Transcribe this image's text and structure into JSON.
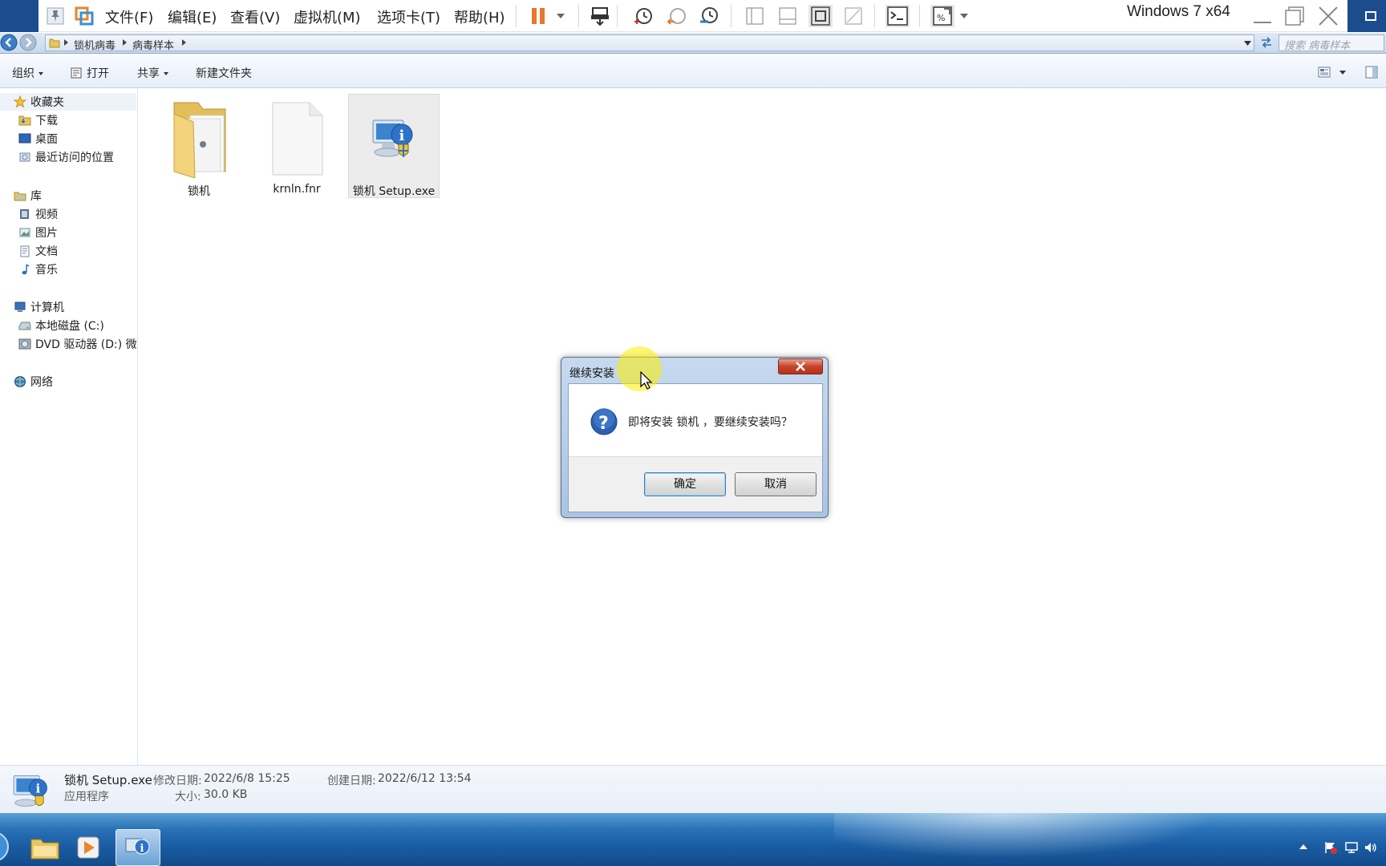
{
  "vmware": {
    "menus": [
      "文件(F)",
      "编辑(E)",
      "查看(V)",
      "虚拟机(M)",
      "选项卡(T)",
      "帮助(H)"
    ],
    "vm_name": "Windows 7 x64"
  },
  "address": {
    "breadcrumbs": [
      "锁机病毒",
      "病毒样本"
    ],
    "search_placeholder": "搜索 病毒样本"
  },
  "commands": {
    "organize": "组织",
    "open": "打开",
    "share": "共享",
    "new_folder": "新建文件夹"
  },
  "nav": {
    "favorites": "收藏夹",
    "downloads": "下载",
    "desktop": "桌面",
    "recent": "最近访问的位置",
    "libraries": "库",
    "videos": "视频",
    "pictures": "图片",
    "documents": "文档",
    "music": "音乐",
    "computer": "计算机",
    "local_disk": "本地磁盘 (C:)",
    "dvd": "DVD 驱动器 (D:) 微P",
    "network": "网络"
  },
  "files": [
    {
      "name": "锁机",
      "type": "folder"
    },
    {
      "name": "krnln.fnr",
      "type": "file"
    },
    {
      "name": "锁机 Setup.exe",
      "type": "installer",
      "selected": true
    }
  ],
  "details": {
    "name": "锁机 Setup.exe",
    "type": "应用程序",
    "modified_label": "修改日期:",
    "modified_value": "2022/6/8 15:25",
    "size_label": "大小:",
    "size_value": "30.0 KB",
    "created_label": "创建日期:",
    "created_value": "2022/6/12 13:54"
  },
  "dialog": {
    "title": "继续安装",
    "message": "即将安装 锁机 ，要继续安装吗？",
    "ok": "确定",
    "cancel": "取消"
  },
  "colors": {
    "taskbar": "#1b5ea4",
    "vm_strip": "#1b4c8e",
    "pause_orange": "#e8762c",
    "dialog_frame": "#a9c4e4"
  }
}
